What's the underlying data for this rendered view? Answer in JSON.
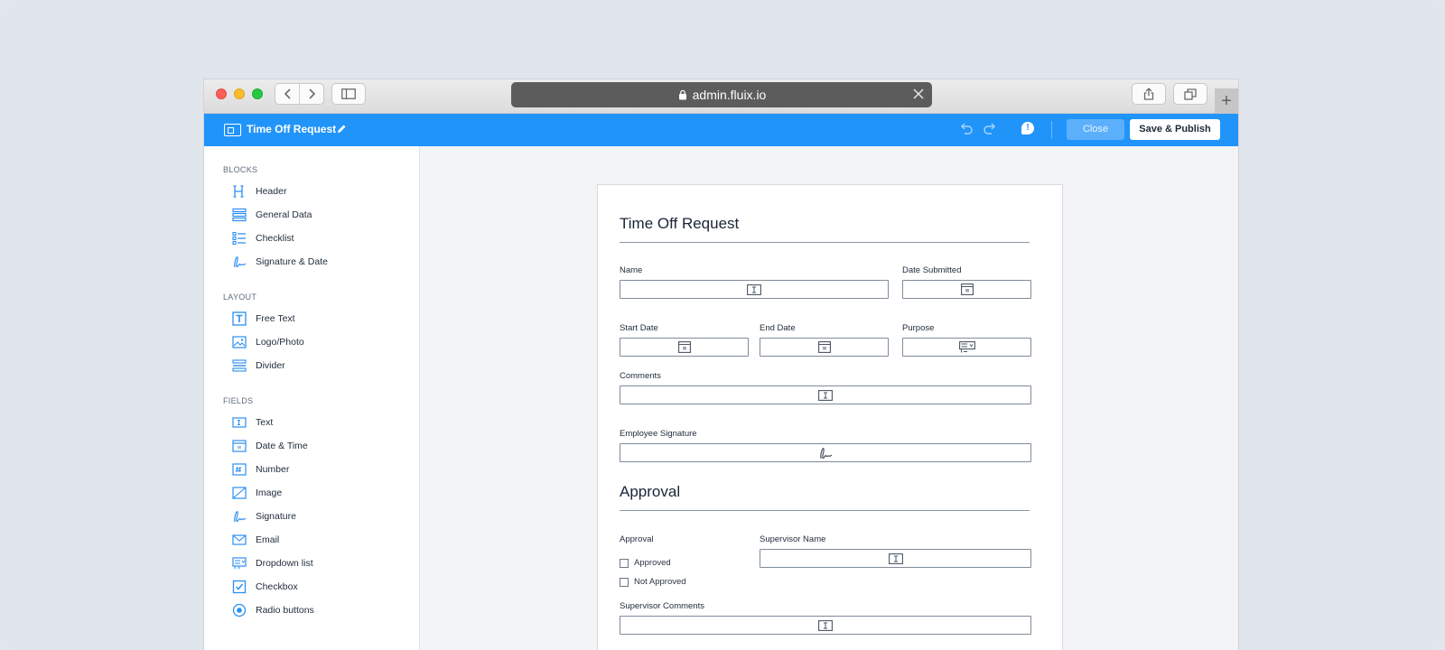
{
  "browser": {
    "url": "admin.fluix.io"
  },
  "appbar": {
    "title": "Time Off Request",
    "close_label": "Close",
    "save_label": "Save & Publish",
    "bubble_glyph": "!"
  },
  "sidebar": {
    "blocks": {
      "heading": "BLOCKS",
      "items": [
        {
          "label": "Header",
          "icon": "header-icon"
        },
        {
          "label": "General Data",
          "icon": "general-data-icon"
        },
        {
          "label": "Checklist",
          "icon": "checklist-icon"
        },
        {
          "label": "Signature & Date",
          "icon": "signature-date-icon"
        }
      ]
    },
    "layout": {
      "heading": "LAYOUT",
      "items": [
        {
          "label": "Free Text",
          "icon": "free-text-icon"
        },
        {
          "label": "Logo/Photo",
          "icon": "logo-photo-icon"
        },
        {
          "label": "Divider",
          "icon": "divider-icon"
        }
      ]
    },
    "fields": {
      "heading": "FIELDS",
      "items": [
        {
          "label": "Text",
          "icon": "text-field-icon"
        },
        {
          "label": "Date & Time",
          "icon": "date-time-icon"
        },
        {
          "label": "Number",
          "icon": "number-icon"
        },
        {
          "label": "Image",
          "icon": "image-icon"
        },
        {
          "label": "Signature",
          "icon": "signature-icon"
        },
        {
          "label": "Email",
          "icon": "email-icon"
        },
        {
          "label": "Dropdown list",
          "icon": "dropdown-list-icon"
        },
        {
          "label": "Checkbox",
          "icon": "checkbox-icon"
        },
        {
          "label": "Radio buttons",
          "icon": "radio-buttons-icon"
        }
      ]
    }
  },
  "form": {
    "title": "Time Off Request",
    "fields": {
      "name": "Name",
      "date_submitted": "Date Submitted",
      "start_date": "Start Date",
      "end_date": "End Date",
      "purpose": "Purpose",
      "comments": "Comments",
      "employee_signature": "Employee Signature"
    },
    "approval_section": {
      "title": "Approval",
      "approval_label": "Approval",
      "options": [
        "Approved",
        "Not Approved"
      ],
      "supervisor_name": "Supervisor Name",
      "supervisor_comments": "Supervisor Comments"
    }
  },
  "colors": {
    "accent": "#2194fa",
    "icon": "#2b8ef2"
  }
}
